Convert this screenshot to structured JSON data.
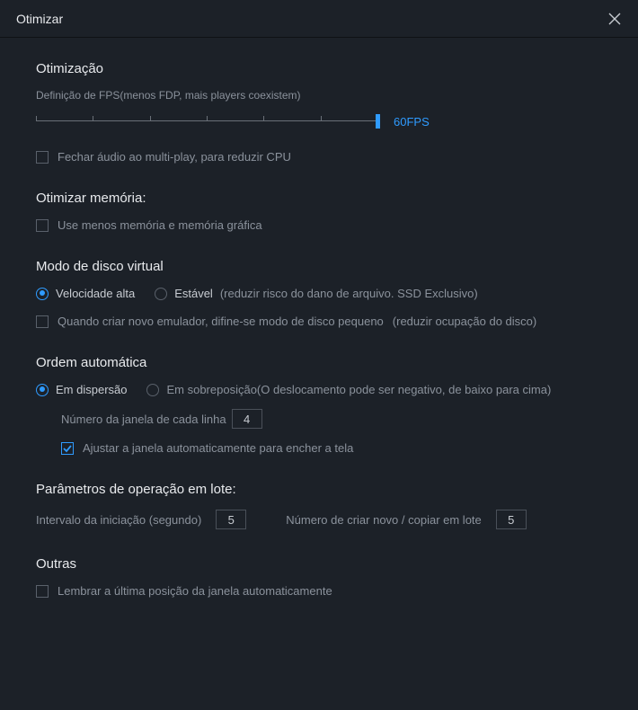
{
  "titlebar": {
    "title": "Otimizar"
  },
  "optimization": {
    "title": "Otimização",
    "fps_caption": "Definição de FPS(menos FDP, mais players coexistem)",
    "fps_value": "60FPS",
    "close_audio": "Fechar áudio ao multi-play, para reduzir CPU"
  },
  "memory": {
    "title": "Otimizar memória:",
    "use_less": "Use menos memória e memória gráfica"
  },
  "disk": {
    "title": "Modo de disco virtual",
    "fast": "Velocidade alta",
    "stable": "Estável",
    "stable_note": "(reduzir risco do dano de arquivo. SSD Exclusivo)",
    "small_disk": "Quando criar novo emulador, difine-se modo de disco pequeno",
    "small_disk_note": "(reduzir ocupação do disco)"
  },
  "order": {
    "title": "Ordem automática",
    "scatter": "Em dispersão",
    "overlay": "Em sobreposição(O deslocamento pode ser negativo, de baixo para cima)",
    "per_row_label": "Número da janela de cada linha",
    "per_row_value": "4",
    "auto_fit": "Ajustar a janela automaticamente para encher a tela"
  },
  "batch": {
    "title": "Parâmetros de operação em lote:",
    "interval_label": "Intervalo da iniciação (segundo)",
    "interval_value": "5",
    "create_label": "Número de criar novo / copiar em lote",
    "create_value": "5"
  },
  "others": {
    "title": "Outras",
    "remember_pos": "Lembrar a última posição da janela automaticamente"
  }
}
